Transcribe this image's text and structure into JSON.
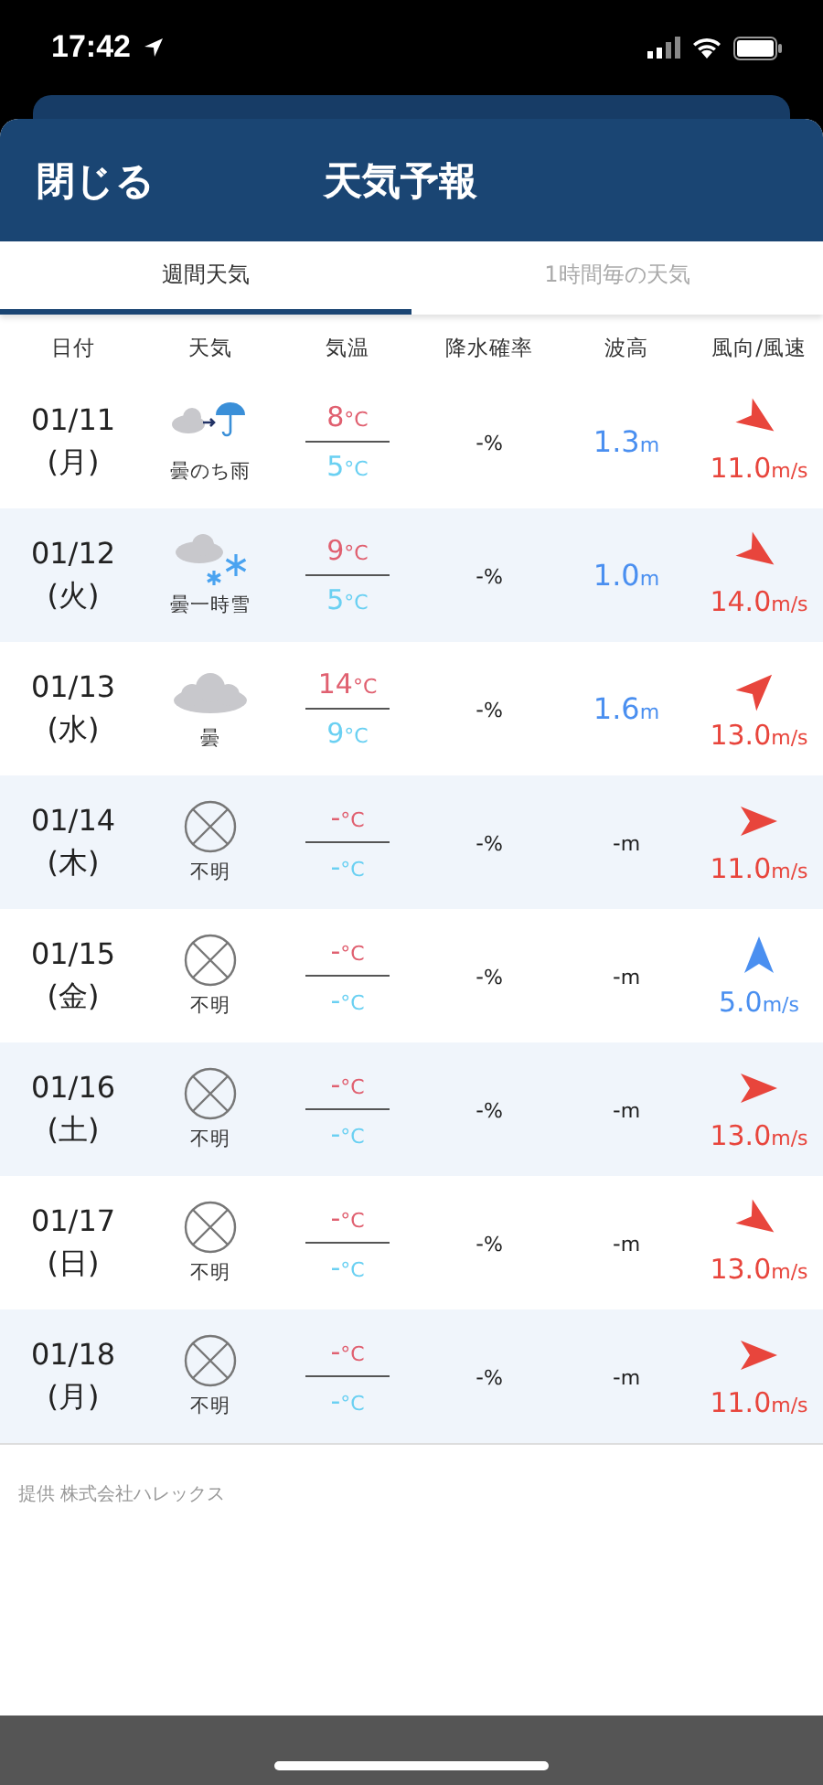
{
  "status_bar": {
    "time": "17:42"
  },
  "header": {
    "close": "閉じる",
    "title": "天気予報"
  },
  "tabs": [
    {
      "label": "週間天気",
      "selected": true
    },
    {
      "label": "1時間毎の天気",
      "selected": false
    }
  ],
  "columns": [
    "日付",
    "天気",
    "気温",
    "降水確率",
    "波高",
    "風向/風速"
  ],
  "rows": [
    {
      "date": "01/11",
      "weekday": "(月)",
      "weather": {
        "kind": "cloud-rain",
        "label": "曇のち雨"
      },
      "high": "8",
      "high_unit": "°C",
      "low": "5",
      "low_unit": "°C",
      "rain": "-",
      "rain_unit": "%",
      "wave": "1.3",
      "wave_unit": "m",
      "wind": {
        "kind": "down-right",
        "speed": "11.0",
        "unit": "m/s",
        "color": "#e8453c"
      }
    },
    {
      "date": "01/12",
      "weekday": "(火)",
      "weather": {
        "kind": "cloud-snow",
        "label": "曇一時雪"
      },
      "high": "9",
      "high_unit": "°C",
      "low": "5",
      "low_unit": "°C",
      "rain": "-",
      "rain_unit": "%",
      "wave": "1.0",
      "wave_unit": "m",
      "wind": {
        "kind": "down-right",
        "speed": "14.0",
        "unit": "m/s",
        "color": "#e8453c"
      }
    },
    {
      "date": "01/13",
      "weekday": "(水)",
      "weather": {
        "kind": "cloud",
        "label": "曇"
      },
      "high": "14",
      "high_unit": "°C",
      "low": "9",
      "low_unit": "°C",
      "rain": "-",
      "rain_unit": "%",
      "wave": "1.6",
      "wave_unit": "m",
      "wind": {
        "kind": "up-right",
        "speed": "13.0",
        "unit": "m/s",
        "color": "#e8453c"
      }
    },
    {
      "date": "01/14",
      "weekday": "(木)",
      "weather": {
        "kind": "unknown",
        "label": "不明"
      },
      "high": "-",
      "high_unit": "°C",
      "low": "-",
      "low_unit": "°C",
      "rain": "-",
      "rain_unit": "%",
      "wave": "-",
      "wave_unit": "m",
      "wind": {
        "kind": "right",
        "speed": "11.0",
        "unit": "m/s",
        "color": "#e8453c"
      }
    },
    {
      "date": "01/15",
      "weekday": "(金)",
      "weather": {
        "kind": "unknown",
        "label": "不明"
      },
      "high": "-",
      "high_unit": "°C",
      "low": "-",
      "low_unit": "°C",
      "rain": "-",
      "rain_unit": "%",
      "wave": "-",
      "wave_unit": "m",
      "wind": {
        "kind": "up",
        "speed": "5.0",
        "unit": "m/s",
        "color": "#4a8ff0"
      }
    },
    {
      "date": "01/16",
      "weekday": "(土)",
      "weather": {
        "kind": "unknown",
        "label": "不明"
      },
      "high": "-",
      "high_unit": "°C",
      "low": "-",
      "low_unit": "°C",
      "rain": "-",
      "rain_unit": "%",
      "wave": "-",
      "wave_unit": "m",
      "wind": {
        "kind": "right",
        "speed": "13.0",
        "unit": "m/s",
        "color": "#e8453c"
      }
    },
    {
      "date": "01/17",
      "weekday": "(日)",
      "weather": {
        "kind": "unknown",
        "label": "不明"
      },
      "high": "-",
      "high_unit": "°C",
      "low": "-",
      "low_unit": "°C",
      "rain": "-",
      "rain_unit": "%",
      "wave": "-",
      "wave_unit": "m",
      "wind": {
        "kind": "down-right",
        "speed": "13.0",
        "unit": "m/s",
        "color": "#e8453c"
      }
    },
    {
      "date": "01/18",
      "weekday": "(月)",
      "weather": {
        "kind": "unknown",
        "label": "不明"
      },
      "high": "-",
      "high_unit": "°C",
      "low": "-",
      "low_unit": "°C",
      "rain": "-",
      "rain_unit": "%",
      "wave": "-",
      "wave_unit": "m",
      "wind": {
        "kind": "right",
        "speed": "11.0",
        "unit": "m/s",
        "color": "#e8453c"
      }
    }
  ],
  "footer": "提供 株式会社ハレックス"
}
